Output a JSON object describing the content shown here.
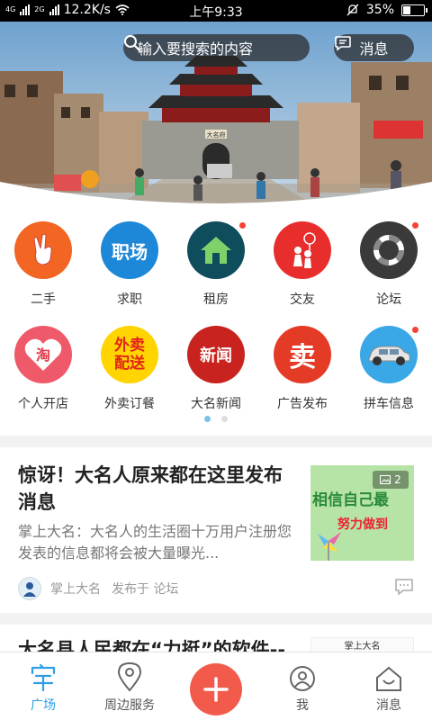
{
  "status_bar": {
    "network_left": "4G",
    "network_right": "2G",
    "speed": "12.2K/s",
    "time": "上午9:33",
    "battery": "35%",
    "battery_level": 0.35
  },
  "header": {
    "search_placeholder": "输入要搜索的内容",
    "message_label": "消息"
  },
  "banner": {
    "sign_text": "大名府"
  },
  "icons": [
    {
      "label": "二手",
      "icon": "victory-hand-icon",
      "color": "#f26522",
      "glyph": "✌",
      "dot": false
    },
    {
      "label": "求职",
      "icon": "job-icon",
      "color": "#1e88d8",
      "glyph": "职场",
      "dot": false
    },
    {
      "label": "租房",
      "icon": "house-icon",
      "color": "#0f4c5c",
      "glyph": "",
      "dot": true
    },
    {
      "label": "交友",
      "icon": "couple-icon",
      "color": "#e82d2d",
      "glyph": "",
      "dot": false
    },
    {
      "label": "论坛",
      "icon": "forum-icon",
      "color": "#3a3a3a",
      "glyph": "",
      "dot": true
    },
    {
      "label": "个人开店",
      "icon": "taobao-heart-icon",
      "color": "#ef5a6a",
      "glyph": "淘",
      "dot": false
    },
    {
      "label": "外卖订餐",
      "icon": "takeout-icon",
      "color": "#ffd400",
      "glyph": "外卖配送",
      "dot": false
    },
    {
      "label": "大名新闻",
      "icon": "news-icon",
      "color": "#c8231e",
      "glyph": "新闻",
      "dot": false
    },
    {
      "label": "广告发布",
      "icon": "sell-icon",
      "color": "#e33b26",
      "glyph": "卖",
      "dot": false
    },
    {
      "label": "拼车信息",
      "icon": "car-icon",
      "color": "#3aa7e6",
      "glyph": "",
      "dot": true
    }
  ],
  "pager": {
    "pages": 2,
    "current": 1
  },
  "feed": [
    {
      "title": "惊讶！大名人原来都在这里发布消息",
      "desc": "掌上大名：大名人的生活圈十万用户注册您发表的信息都将会被大量曝光...",
      "image_count": "2",
      "thumb_text_1": "相信自己最",
      "thumb_text_2": "努力做到",
      "author": "掌上大名",
      "posted_in": "发布于 论坛"
    },
    {
      "title": "大名县人民都在“力挺”的软件--",
      "thumb_text": "掌上大名"
    }
  ],
  "tabbar": {
    "items": [
      {
        "label": "广场",
        "icon": "square-icon",
        "active": true
      },
      {
        "label": "周边服务",
        "icon": "location-pin-icon",
        "active": false
      },
      {
        "label": "我",
        "icon": "user-icon",
        "active": false
      },
      {
        "label": "消息",
        "icon": "home-message-icon",
        "active": false
      }
    ],
    "accent": "#2e9ee6",
    "plus_color": "#f25b4b"
  }
}
